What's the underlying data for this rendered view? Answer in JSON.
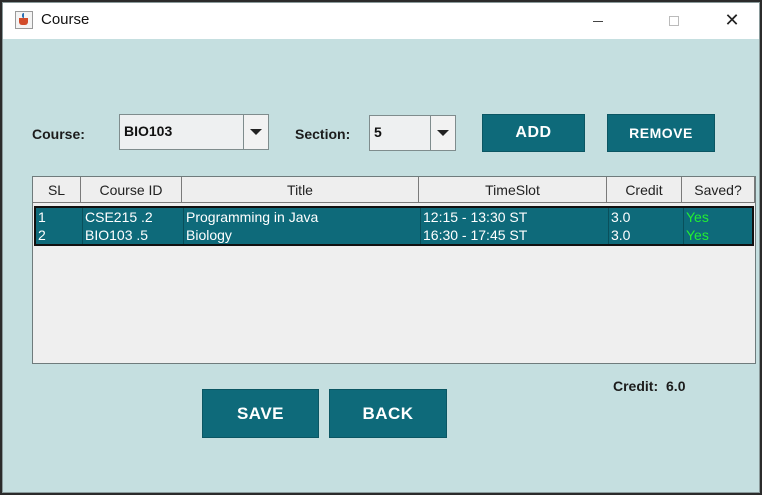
{
  "window": {
    "title": "Course"
  },
  "form": {
    "course_label": "Course:",
    "course_value": "BIO103",
    "section_label": "Section:",
    "section_value": "5",
    "add_label": "ADD",
    "remove_label": "REMOVE"
  },
  "table": {
    "columns": [
      "SL",
      "Course ID",
      "Title",
      "TimeSlot",
      "Credit",
      "Saved?"
    ],
    "rows": [
      {
        "sl": "1",
        "course_id": "CSE215 .2",
        "title": "Programming in Java",
        "timeslot": "12:15 - 13:30 ST",
        "credit": "3.0",
        "saved": "Yes"
      },
      {
        "sl": "2",
        "course_id": "BIO103 .5",
        "title": "Biology",
        "timeslot": "16:30 - 17:45 ST",
        "credit": "3.0",
        "saved": "Yes"
      }
    ]
  },
  "footer": {
    "credit_label": "Credit:",
    "credit_value": "6.0",
    "save_label": "SAVE",
    "back_label": "BACK"
  },
  "colors": {
    "background": "#c5dfe0",
    "accent": "#0e6a7a",
    "saved_text": "#22ee33"
  }
}
